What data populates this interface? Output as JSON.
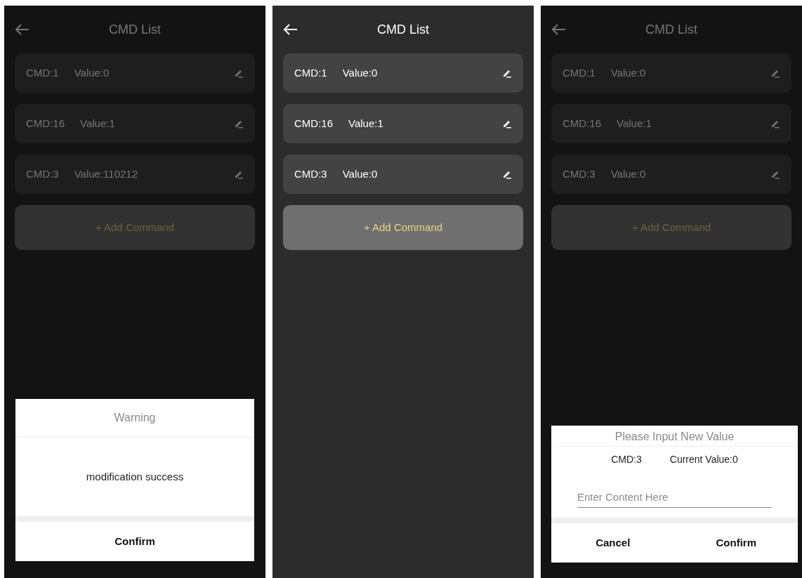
{
  "screens": [
    {
      "title": "CMD List",
      "dimmed": true,
      "commands": [
        {
          "cmd": "CMD:1",
          "value": "Value:0"
        },
        {
          "cmd": "CMD:16",
          "value": "Value:1"
        },
        {
          "cmd": "CMD:3",
          "value": "Value:110212"
        }
      ],
      "add_button": "+ Add Command",
      "dialog": {
        "kind": "alert",
        "title": "Warning",
        "message": "modification success",
        "buttons": [
          "Confirm"
        ]
      }
    },
    {
      "title": "CMD List",
      "dimmed": false,
      "commands": [
        {
          "cmd": "CMD:1",
          "value": "Value:0"
        },
        {
          "cmd": "CMD:16",
          "value": "Value:1"
        },
        {
          "cmd": "CMD:3",
          "value": "Value:0"
        }
      ],
      "add_button": "+ Add Command"
    },
    {
      "title": "CMD List",
      "dimmed": true,
      "commands": [
        {
          "cmd": "CMD:1",
          "value": "Value:0"
        },
        {
          "cmd": "CMD:16",
          "value": "Value:1"
        },
        {
          "cmd": "CMD:3",
          "value": "Value:0"
        }
      ],
      "add_button": "+ Add Command",
      "dialog": {
        "kind": "input",
        "title": "Please Input New Value",
        "cmd": "CMD:3",
        "current": "Current Value:0",
        "placeholder": "Enter Content Here",
        "buttons": [
          "Cancel",
          "Confirm"
        ]
      }
    }
  ]
}
